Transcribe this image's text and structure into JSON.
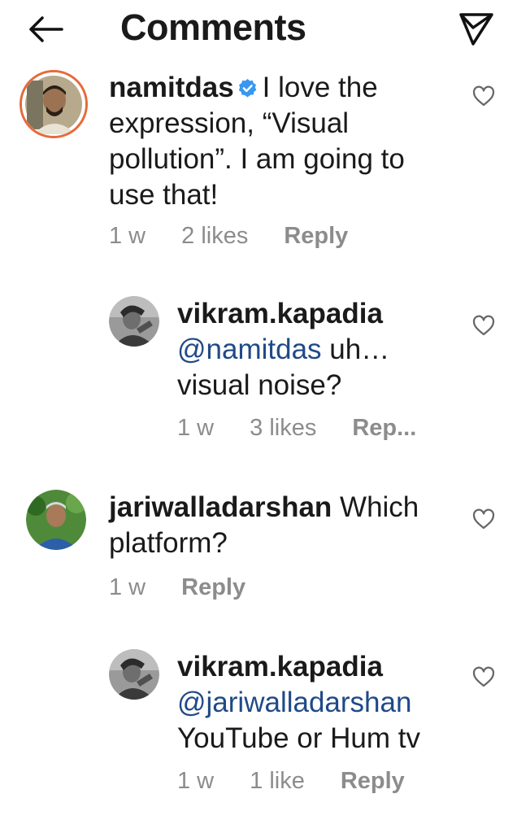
{
  "header": {
    "title": "Comments"
  },
  "comments": [
    {
      "user": "namitdas",
      "text": "I love the expression, “Visual pollution”. I am going to use that!",
      "time": "1 w",
      "likes": "2 likes",
      "reply": "Reply"
    },
    {
      "user": "vikram.kapadia",
      "mention": "@namitdas",
      "text": "uh… visual noise?",
      "time": "1 w",
      "likes": "3 likes",
      "reply": "Rep..."
    },
    {
      "user": "jariwalladarshan",
      "text": "Which platform?",
      "time": "1 w",
      "reply": "Reply"
    },
    {
      "user": "vikram.kapadia",
      "mention": "@jariwalladarshan",
      "text": "YouTube or Hum tv",
      "time": "1 w",
      "likes": "1 like",
      "reply": "Reply"
    }
  ],
  "colors": {
    "mention": "#1f4a86",
    "verified": "#3897f0",
    "meta": "#8c8c8c"
  },
  "icons": [
    "back-arrow-icon",
    "send-icon",
    "heart-icon",
    "verified-badge-icon"
  ]
}
